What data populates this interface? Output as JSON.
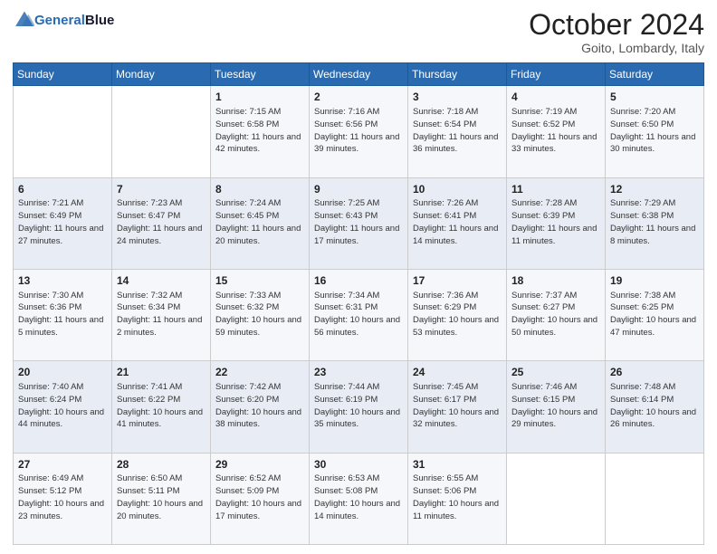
{
  "header": {
    "logo_general": "General",
    "logo_blue": "Blue",
    "month": "October 2024",
    "location": "Goito, Lombardy, Italy"
  },
  "weekdays": [
    "Sunday",
    "Monday",
    "Tuesday",
    "Wednesday",
    "Thursday",
    "Friday",
    "Saturday"
  ],
  "weeks": [
    [
      {
        "day": "",
        "info": ""
      },
      {
        "day": "",
        "info": ""
      },
      {
        "day": "1",
        "info": "Sunrise: 7:15 AM\nSunset: 6:58 PM\nDaylight: 11 hours and 42 minutes."
      },
      {
        "day": "2",
        "info": "Sunrise: 7:16 AM\nSunset: 6:56 PM\nDaylight: 11 hours and 39 minutes."
      },
      {
        "day": "3",
        "info": "Sunrise: 7:18 AM\nSunset: 6:54 PM\nDaylight: 11 hours and 36 minutes."
      },
      {
        "day": "4",
        "info": "Sunrise: 7:19 AM\nSunset: 6:52 PM\nDaylight: 11 hours and 33 minutes."
      },
      {
        "day": "5",
        "info": "Sunrise: 7:20 AM\nSunset: 6:50 PM\nDaylight: 11 hours and 30 minutes."
      }
    ],
    [
      {
        "day": "6",
        "info": "Sunrise: 7:21 AM\nSunset: 6:49 PM\nDaylight: 11 hours and 27 minutes."
      },
      {
        "day": "7",
        "info": "Sunrise: 7:23 AM\nSunset: 6:47 PM\nDaylight: 11 hours and 24 minutes."
      },
      {
        "day": "8",
        "info": "Sunrise: 7:24 AM\nSunset: 6:45 PM\nDaylight: 11 hours and 20 minutes."
      },
      {
        "day": "9",
        "info": "Sunrise: 7:25 AM\nSunset: 6:43 PM\nDaylight: 11 hours and 17 minutes."
      },
      {
        "day": "10",
        "info": "Sunrise: 7:26 AM\nSunset: 6:41 PM\nDaylight: 11 hours and 14 minutes."
      },
      {
        "day": "11",
        "info": "Sunrise: 7:28 AM\nSunset: 6:39 PM\nDaylight: 11 hours and 11 minutes."
      },
      {
        "day": "12",
        "info": "Sunrise: 7:29 AM\nSunset: 6:38 PM\nDaylight: 11 hours and 8 minutes."
      }
    ],
    [
      {
        "day": "13",
        "info": "Sunrise: 7:30 AM\nSunset: 6:36 PM\nDaylight: 11 hours and 5 minutes."
      },
      {
        "day": "14",
        "info": "Sunrise: 7:32 AM\nSunset: 6:34 PM\nDaylight: 11 hours and 2 minutes."
      },
      {
        "day": "15",
        "info": "Sunrise: 7:33 AM\nSunset: 6:32 PM\nDaylight: 10 hours and 59 minutes."
      },
      {
        "day": "16",
        "info": "Sunrise: 7:34 AM\nSunset: 6:31 PM\nDaylight: 10 hours and 56 minutes."
      },
      {
        "day": "17",
        "info": "Sunrise: 7:36 AM\nSunset: 6:29 PM\nDaylight: 10 hours and 53 minutes."
      },
      {
        "day": "18",
        "info": "Sunrise: 7:37 AM\nSunset: 6:27 PM\nDaylight: 10 hours and 50 minutes."
      },
      {
        "day": "19",
        "info": "Sunrise: 7:38 AM\nSunset: 6:25 PM\nDaylight: 10 hours and 47 minutes."
      }
    ],
    [
      {
        "day": "20",
        "info": "Sunrise: 7:40 AM\nSunset: 6:24 PM\nDaylight: 10 hours and 44 minutes."
      },
      {
        "day": "21",
        "info": "Sunrise: 7:41 AM\nSunset: 6:22 PM\nDaylight: 10 hours and 41 minutes."
      },
      {
        "day": "22",
        "info": "Sunrise: 7:42 AM\nSunset: 6:20 PM\nDaylight: 10 hours and 38 minutes."
      },
      {
        "day": "23",
        "info": "Sunrise: 7:44 AM\nSunset: 6:19 PM\nDaylight: 10 hours and 35 minutes."
      },
      {
        "day": "24",
        "info": "Sunrise: 7:45 AM\nSunset: 6:17 PM\nDaylight: 10 hours and 32 minutes."
      },
      {
        "day": "25",
        "info": "Sunrise: 7:46 AM\nSunset: 6:15 PM\nDaylight: 10 hours and 29 minutes."
      },
      {
        "day": "26",
        "info": "Sunrise: 7:48 AM\nSunset: 6:14 PM\nDaylight: 10 hours and 26 minutes."
      }
    ],
    [
      {
        "day": "27",
        "info": "Sunrise: 6:49 AM\nSunset: 5:12 PM\nDaylight: 10 hours and 23 minutes."
      },
      {
        "day": "28",
        "info": "Sunrise: 6:50 AM\nSunset: 5:11 PM\nDaylight: 10 hours and 20 minutes."
      },
      {
        "day": "29",
        "info": "Sunrise: 6:52 AM\nSunset: 5:09 PM\nDaylight: 10 hours and 17 minutes."
      },
      {
        "day": "30",
        "info": "Sunrise: 6:53 AM\nSunset: 5:08 PM\nDaylight: 10 hours and 14 minutes."
      },
      {
        "day": "31",
        "info": "Sunrise: 6:55 AM\nSunset: 5:06 PM\nDaylight: 10 hours and 11 minutes."
      },
      {
        "day": "",
        "info": ""
      },
      {
        "day": "",
        "info": ""
      }
    ]
  ]
}
